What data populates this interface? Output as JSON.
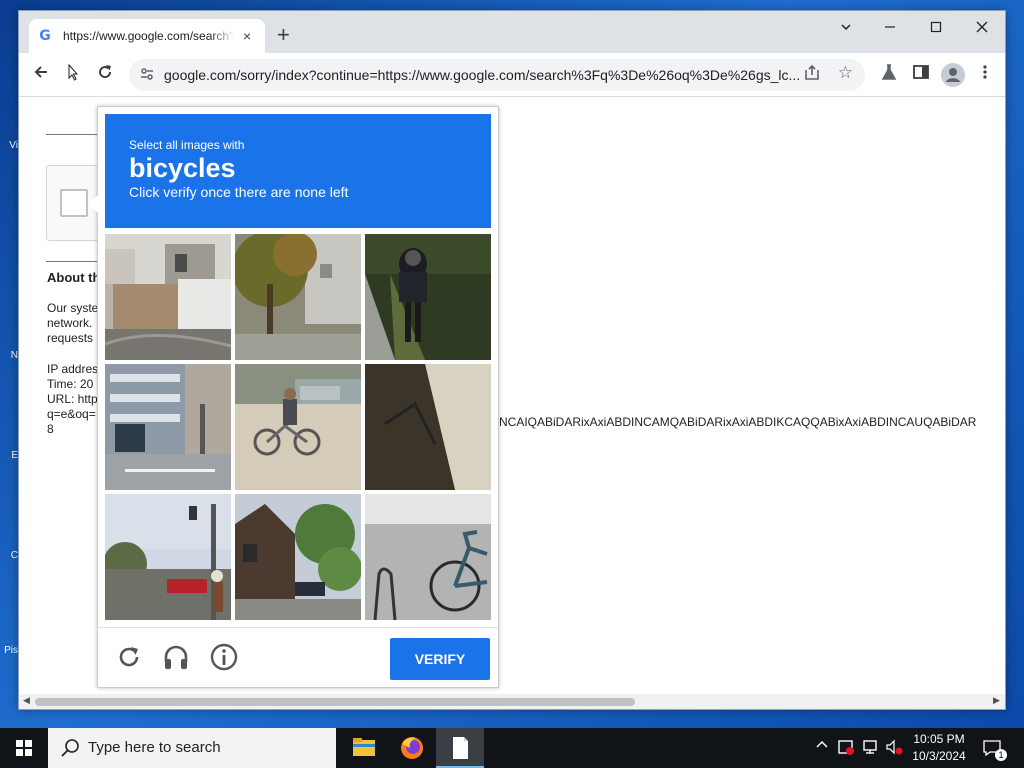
{
  "desktop": {
    "icons": [
      "Vi",
      "N",
      "E",
      "C",
      "Pis"
    ]
  },
  "browser": {
    "tab_title": "https://www.google.com/search?",
    "tab_close": "×",
    "new_tab": "+",
    "url": "google.com/sorry/index?continue=https://www.google.com/search%3Fq%3De%26oq%3De%26gs_lc..."
  },
  "page": {
    "about_heading": "About th",
    "para1_l1": "Our syste",
    "para1_l2": "network.",
    "para1_l3": "requests",
    "ip_label": "IP addres",
    "time_label": "Time: 20",
    "url_label": "URL: http",
    "url_line2": "q=e&oq=",
    "url_line3": "8",
    "url_tail": "NCAIQABiDARixAxiABDINCAMQABiDARixAxiABDIKCAQQABixAxiABDINCAUQABiDAR"
  },
  "captcha": {
    "instruction_line1": "Select all images with",
    "target": "bicycles",
    "instruction_line3": "Click verify once there are none left",
    "verify_label": "VERIFY",
    "tiles": [
      "fence-street",
      "tree-street",
      "cyclist-rear",
      "apartment-building",
      "cyclist-street",
      "wall-corner",
      "traffic-light-street",
      "house-trees",
      "parked-bicycle"
    ]
  },
  "taskbar": {
    "search_placeholder": "Type here to search",
    "time": "10:05 PM",
    "date": "10/3/2024",
    "notification_count": "1"
  },
  "colors": {
    "captcha_blue": "#1a73e8",
    "taskbar": "#101418"
  }
}
